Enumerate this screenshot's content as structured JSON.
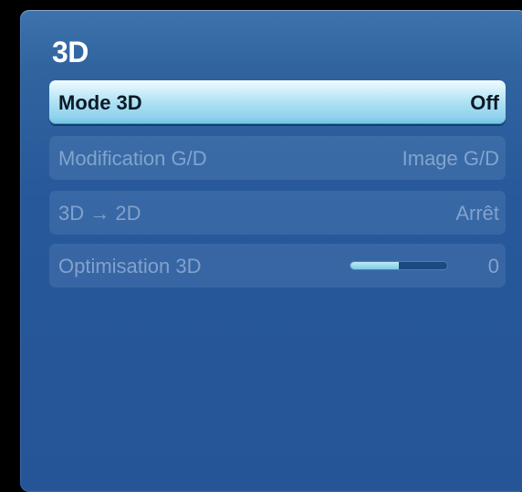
{
  "menu": {
    "title": "3D",
    "items": [
      {
        "label": "Mode 3D",
        "value": "Off",
        "selected": true
      },
      {
        "label": "Modification G/D",
        "value": "Image G/D",
        "selected": false
      },
      {
        "label": "3D → 2D",
        "value": "Arrêt",
        "selected": false
      },
      {
        "label": "Optimisation 3D",
        "value": "0",
        "selected": false,
        "slider_fraction": 0.5
      }
    ]
  },
  "colors": {
    "panel": "#2a5c9c",
    "highlight": "#a8dff2",
    "dimmed_text": "#bed4ec"
  }
}
